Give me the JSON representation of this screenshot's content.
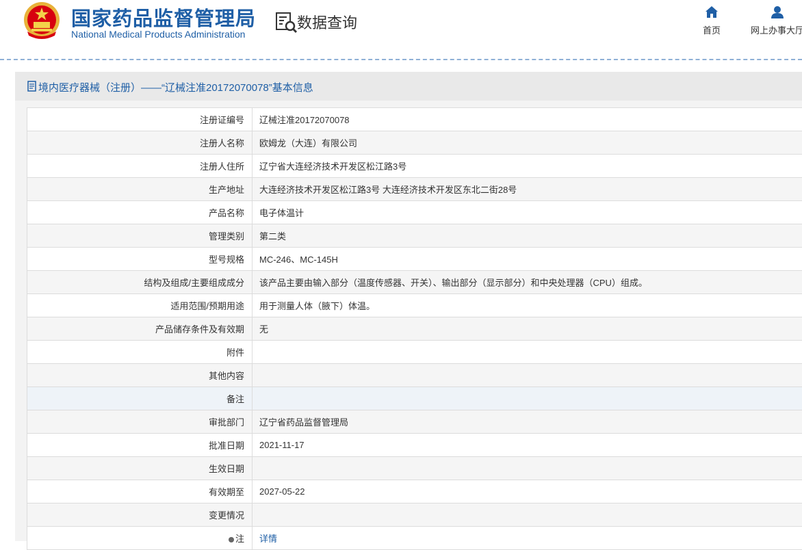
{
  "header": {
    "logo_cn": "国家药品监督管理局",
    "logo_en": "National Medical Products Administration",
    "page_title": "数据查询",
    "nav": [
      {
        "label": "首页",
        "icon": "home-icon"
      },
      {
        "label": "网上办事大厅",
        "icon": "user-icon"
      }
    ]
  },
  "section": {
    "title": "境内医疗器械（注册）——“辽械注准20172070078”基本信息"
  },
  "rows": [
    {
      "label": "注册证编号",
      "value": "辽械注准20172070078"
    },
    {
      "label": "注册人名称",
      "value": "欧姆龙（大连）有限公司"
    },
    {
      "label": "注册人住所",
      "value": "辽宁省大连经济技术开发区松江路3号"
    },
    {
      "label": "生产地址",
      "value": "大连经济技术开发区松江路3号 大连经济技术开发区东北二街28号"
    },
    {
      "label": "产品名称",
      "value": "电子体温计"
    },
    {
      "label": "管理类别",
      "value": "第二类"
    },
    {
      "label": "型号规格",
      "value": "MC-246、MC-145H"
    },
    {
      "label": "结构及组成/主要组成成分",
      "value": "该产品主要由输入部分（温度传感器、开关）、输出部分（显示部分）和中央处理器（CPU）组成。"
    },
    {
      "label": "适用范围/预期用途",
      "value": "用于测量人体（腋下）体温。"
    },
    {
      "label": "产品储存条件及有效期",
      "value": "无"
    },
    {
      "label": "附件",
      "value": ""
    },
    {
      "label": "其他内容",
      "value": ""
    },
    {
      "label": "备注",
      "value": ""
    },
    {
      "label": "审批部门",
      "value": "辽宁省药品监督管理局"
    },
    {
      "label": "批准日期",
      "value": "2021-11-17"
    },
    {
      "label": "生效日期",
      "value": ""
    },
    {
      "label": "有效期至",
      "value": "2027-05-22"
    },
    {
      "label": "变更情况",
      "value": ""
    },
    {
      "label": "注",
      "value": "详情"
    }
  ],
  "colors": {
    "brand_blue": "#1f5fa6",
    "emblem_red": "#d7000f",
    "emblem_gold": "#f3c44a"
  }
}
